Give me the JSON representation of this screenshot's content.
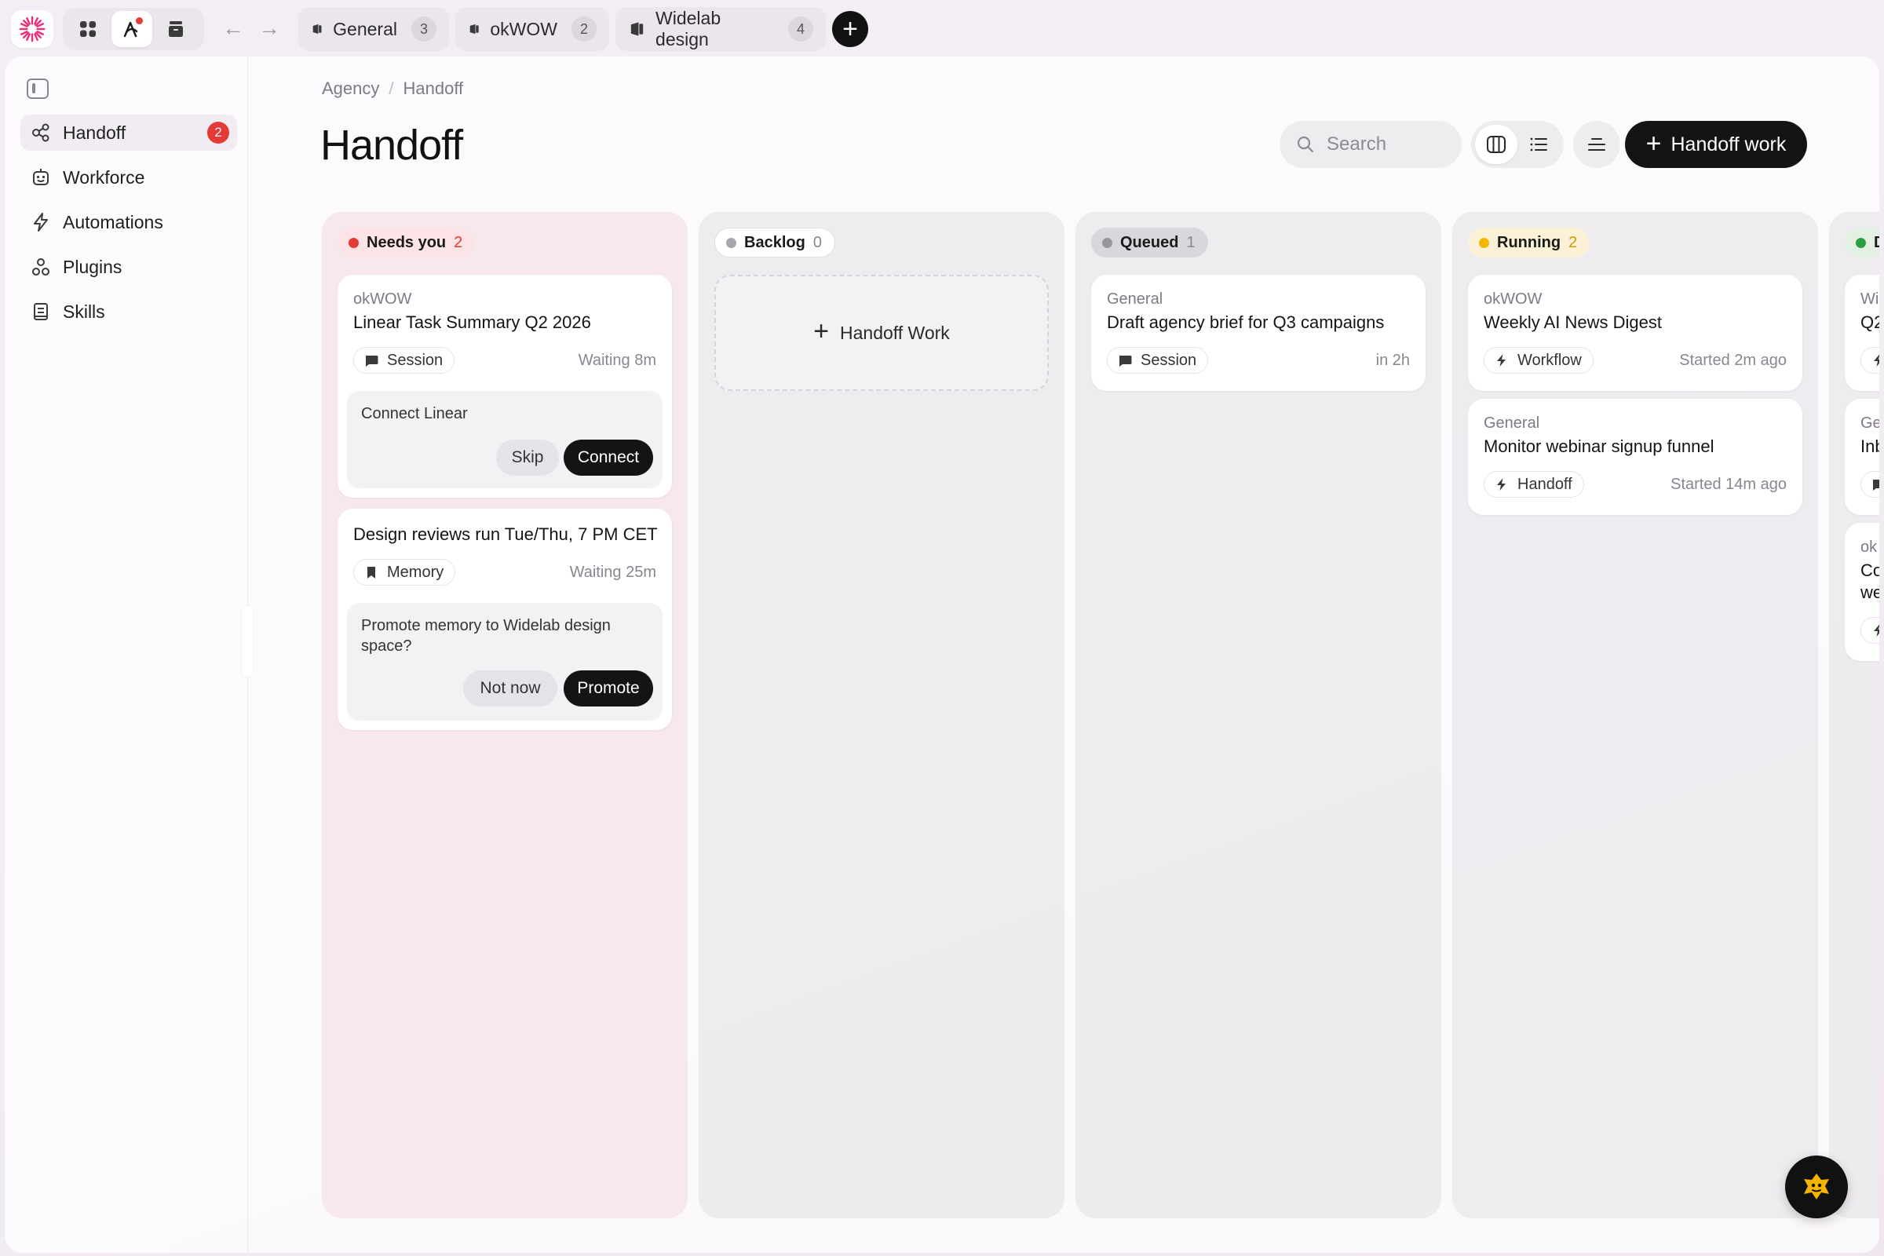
{
  "tabs": [
    {
      "label": "General",
      "count": "3"
    },
    {
      "label": "okWOW",
      "count": "2"
    },
    {
      "label": "Widelab design",
      "count": "4"
    }
  ],
  "sidebar": {
    "items": [
      {
        "label": "Handoff",
        "badge": "2"
      },
      {
        "label": "Workforce"
      },
      {
        "label": "Automations"
      },
      {
        "label": "Plugins"
      },
      {
        "label": "Skills"
      }
    ]
  },
  "breadcrumb": [
    "Agency",
    "Handoff"
  ],
  "page_title": "Handoff",
  "search": {
    "placeholder": "Search"
  },
  "primary_action": "Handoff work",
  "columns": {
    "needs_you": {
      "label": "Needs you",
      "count": "2",
      "color": "#e53935",
      "cards": [
        {
          "space": "okWOW",
          "title": "Linear Task Summary Q2 2026",
          "tag": "Session",
          "meta": "Waiting 8m",
          "action_text": "Connect Linear",
          "secondary": "Skip",
          "primary": "Connect"
        },
        {
          "title": "Design reviews run Tue/Thu, 7 PM CET",
          "tag": "Memory",
          "meta": "Waiting 25m",
          "action_text": "Promote memory to Widelab design space?",
          "secondary": "Not now",
          "primary": "Promote"
        }
      ]
    },
    "backlog": {
      "label": "Backlog",
      "count": "0",
      "color": "#a9a5ad",
      "add_label": "Handoff Work"
    },
    "queued": {
      "label": "Queued",
      "count": "1",
      "color": "#9a969e",
      "cards": [
        {
          "space": "General",
          "title": "Draft agency brief for Q3 campaigns",
          "tag": "Session",
          "meta": "in 2h"
        }
      ]
    },
    "running": {
      "label": "Running",
      "count": "2",
      "color": "#f2b705",
      "cards": [
        {
          "space": "okWOW",
          "title": "Weekly AI News Digest",
          "tag": "Workflow",
          "meta": "Started 2m ago"
        },
        {
          "space": "General",
          "title": "Monitor webinar signup funnel",
          "tag": "Handoff",
          "meta": "Started 14m ago"
        }
      ]
    },
    "done_partial": {
      "label": "D",
      "color": "#2e9e44",
      "cards": [
        {
          "space": "Wi",
          "title": "Q2"
        },
        {
          "space": "Ge",
          "title": "Inb"
        },
        {
          "space": "ok",
          "title": "Co",
          "title2": "we"
        }
      ]
    }
  }
}
